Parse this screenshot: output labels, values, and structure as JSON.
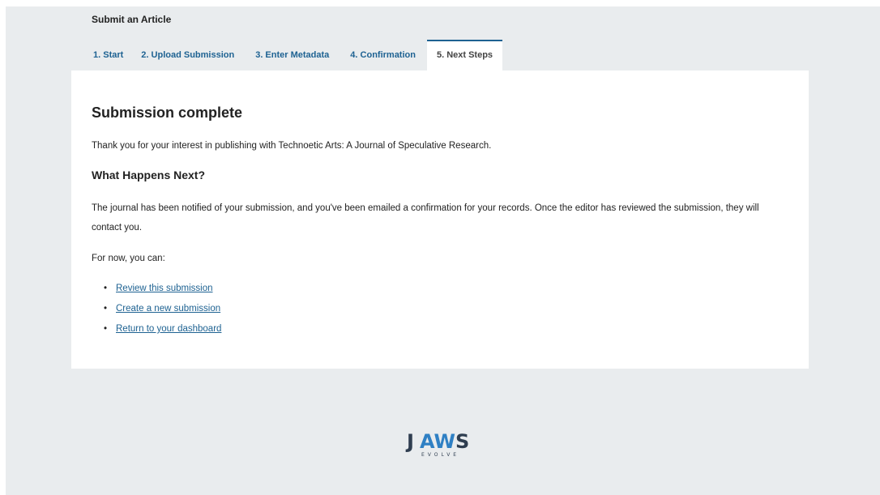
{
  "page": {
    "heading": "Submit an Article"
  },
  "tabs": [
    {
      "label": "1. Start"
    },
    {
      "label": "2. Upload Submission"
    },
    {
      "label": "3. Enter Metadata"
    },
    {
      "label": "4. Confirmation"
    },
    {
      "label": "5. Next Steps",
      "active": true
    }
  ],
  "panel": {
    "title": "Submission complete",
    "intro": "Thank you for your interest in publishing with Technoetic Arts: A Journal of Speculative Research.",
    "subtitle": "What Happens Next?",
    "body": "The journal has been notified of your submission, and you've been emailed a confirmation for your records. Once the editor has reviewed the submission, they will contact you.",
    "for_now": "For now, you can:",
    "links": [
      {
        "label": "Review this submission"
      },
      {
        "label": "Create a new submission"
      },
      {
        "label": "Return to your dashboard"
      }
    ]
  },
  "footer": {
    "logo_text": "JAWS",
    "logo_tagline": "EVOLVE"
  },
  "colors": {
    "link": "#1e6292",
    "background": "#e9ecee",
    "logo_dark": "#2f3e50",
    "logo_accent": "#2f80c4"
  }
}
